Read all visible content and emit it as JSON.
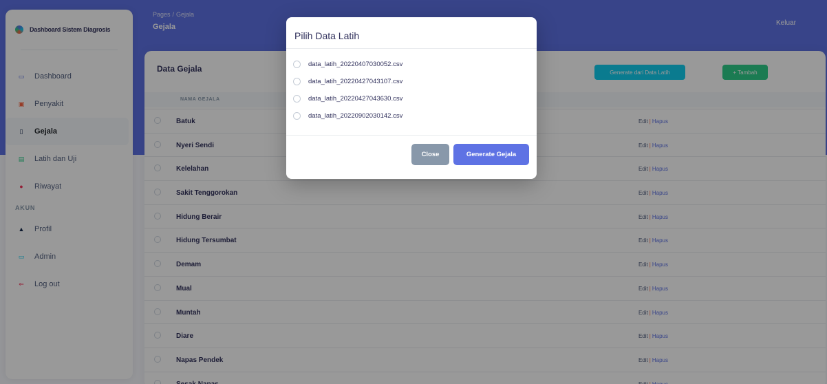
{
  "app": {
    "brand": "Dashboard Sistem Diagrosis"
  },
  "breadcrumb": {
    "root": "Pages",
    "separator": "/",
    "current": "Gejala"
  },
  "header": {
    "page_title": "Gejala",
    "logout_link": "Keluar"
  },
  "sidebar": {
    "items": [
      {
        "label": "Dashboard",
        "icon": "monitor-icon",
        "color": "#5e72e4"
      },
      {
        "label": "Penyakit",
        "icon": "file-icon",
        "color": "#fb6340"
      },
      {
        "label": "Gejala",
        "icon": "clipboard-icon",
        "color": "#172b4d",
        "active": true
      },
      {
        "label": "Latih dan Uji",
        "icon": "document-icon",
        "color": "#2dce89"
      },
      {
        "label": "Riwayat",
        "icon": "circle-icon",
        "color": "#f5365c"
      }
    ],
    "section_heading": "AKUN",
    "account_items": [
      {
        "label": "Profil",
        "icon": "user-icon",
        "color": "#172b4d"
      },
      {
        "label": "Admin",
        "icon": "id-card-icon",
        "color": "#11cdef"
      },
      {
        "label": "Log out",
        "icon": "logout-icon",
        "color": "#f5365c"
      }
    ]
  },
  "card": {
    "title": "Data Gejala",
    "generate_button": "Generate dari Data Latih",
    "add_button": "+ Tambah",
    "column_header": "NAMA GEJALA",
    "rows": [
      {
        "name": "Batuk",
        "edit": "Edit",
        "sep": "|",
        "delete": "Hapus"
      },
      {
        "name": "Nyeri Sendi",
        "edit": "Edit",
        "sep": "|",
        "delete": "Hapus"
      },
      {
        "name": "Kelelahan",
        "edit": "Edit",
        "sep": "|",
        "delete": "Hapus"
      },
      {
        "name": "Sakit Tenggorokan",
        "edit": "Edit",
        "sep": "|",
        "delete": "Hapus"
      },
      {
        "name": "Hidung Berair",
        "edit": "Edit",
        "sep": "|",
        "delete": "Hapus"
      },
      {
        "name": "Hidung Tersumbat",
        "edit": "Edit",
        "sep": "|",
        "delete": "Hapus"
      },
      {
        "name": "Demam",
        "edit": "Edit",
        "sep": "|",
        "delete": "Hapus"
      },
      {
        "name": "Mual",
        "edit": "Edit",
        "sep": "|",
        "delete": "Hapus"
      },
      {
        "name": "Muntah",
        "edit": "Edit",
        "sep": "|",
        "delete": "Hapus"
      },
      {
        "name": "Diare",
        "edit": "Edit",
        "sep": "|",
        "delete": "Hapus"
      },
      {
        "name": "Napas Pendek",
        "edit": "Edit",
        "sep": "|",
        "delete": "Hapus"
      },
      {
        "name": "Sesak Napas",
        "edit": "Edit",
        "sep": "|",
        "delete": "Hapus"
      }
    ]
  },
  "modal": {
    "title": "Pilih Data Latih",
    "options": [
      "data_latih_20220407030052.csv",
      "data_latih_20220427043107.csv",
      "data_latih_20220427043630.csv",
      "data_latih_20220902030142.csv"
    ],
    "close_button": "Close",
    "submit_button": "Generate Gejala"
  }
}
